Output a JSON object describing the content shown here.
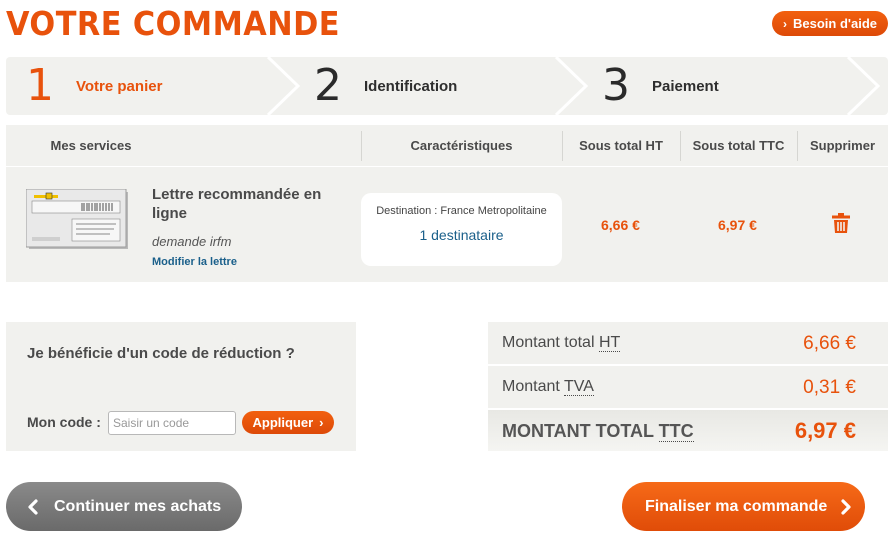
{
  "page": {
    "title": "VOTRE COMMANDE"
  },
  "help": {
    "label": "Besoin d'aide"
  },
  "steps": [
    {
      "number": "1",
      "label": "Votre panier",
      "active": true
    },
    {
      "number": "2",
      "label": "Identification",
      "active": false
    },
    {
      "number": "3",
      "label": "Paiement",
      "active": false
    }
  ],
  "cart": {
    "headers": {
      "services": "Mes services",
      "characteristics": "Caractéristiques",
      "subtotal_ht": "Sous total HT",
      "subtotal_ttc": "Sous total TTC",
      "delete": "Supprimer"
    },
    "items": [
      {
        "title": "Lettre recommandée en ligne",
        "subtitle": "demande irfm",
        "modify_link": "Modifier la lettre",
        "destination": "Destination : France Metropolitaine",
        "recipients": "1 destinataire",
        "subtotal_ht": "6,66 €",
        "subtotal_ttc": "6,97 €"
      }
    ]
  },
  "promo": {
    "question": "Je bénéficie d'un code de réduction ?",
    "code_label": "Mon code :",
    "input_value": "",
    "input_placeholder": "Saisir un code",
    "apply_label": "Appliquer"
  },
  "totals": {
    "ht_label_prefix": "Montant total ",
    "ht_abbr": "HT",
    "ht_value": "6,66 €",
    "tva_label_prefix": "Montant ",
    "tva_abbr": "TVA",
    "tva_value": "0,31 €",
    "ttc_label_prefix": "MONTANT TOTAL ",
    "ttc_abbr": "TTC",
    "ttc_value": "6,97 €"
  },
  "actions": {
    "continue_label": "Continuer mes achats",
    "finalize_label": "Finaliser ma commande"
  },
  "colors": {
    "accent": "#e8520c",
    "link": "#1a5f8a",
    "panel": "#f1f1ee",
    "secondary_button": "#7a7a7a"
  }
}
